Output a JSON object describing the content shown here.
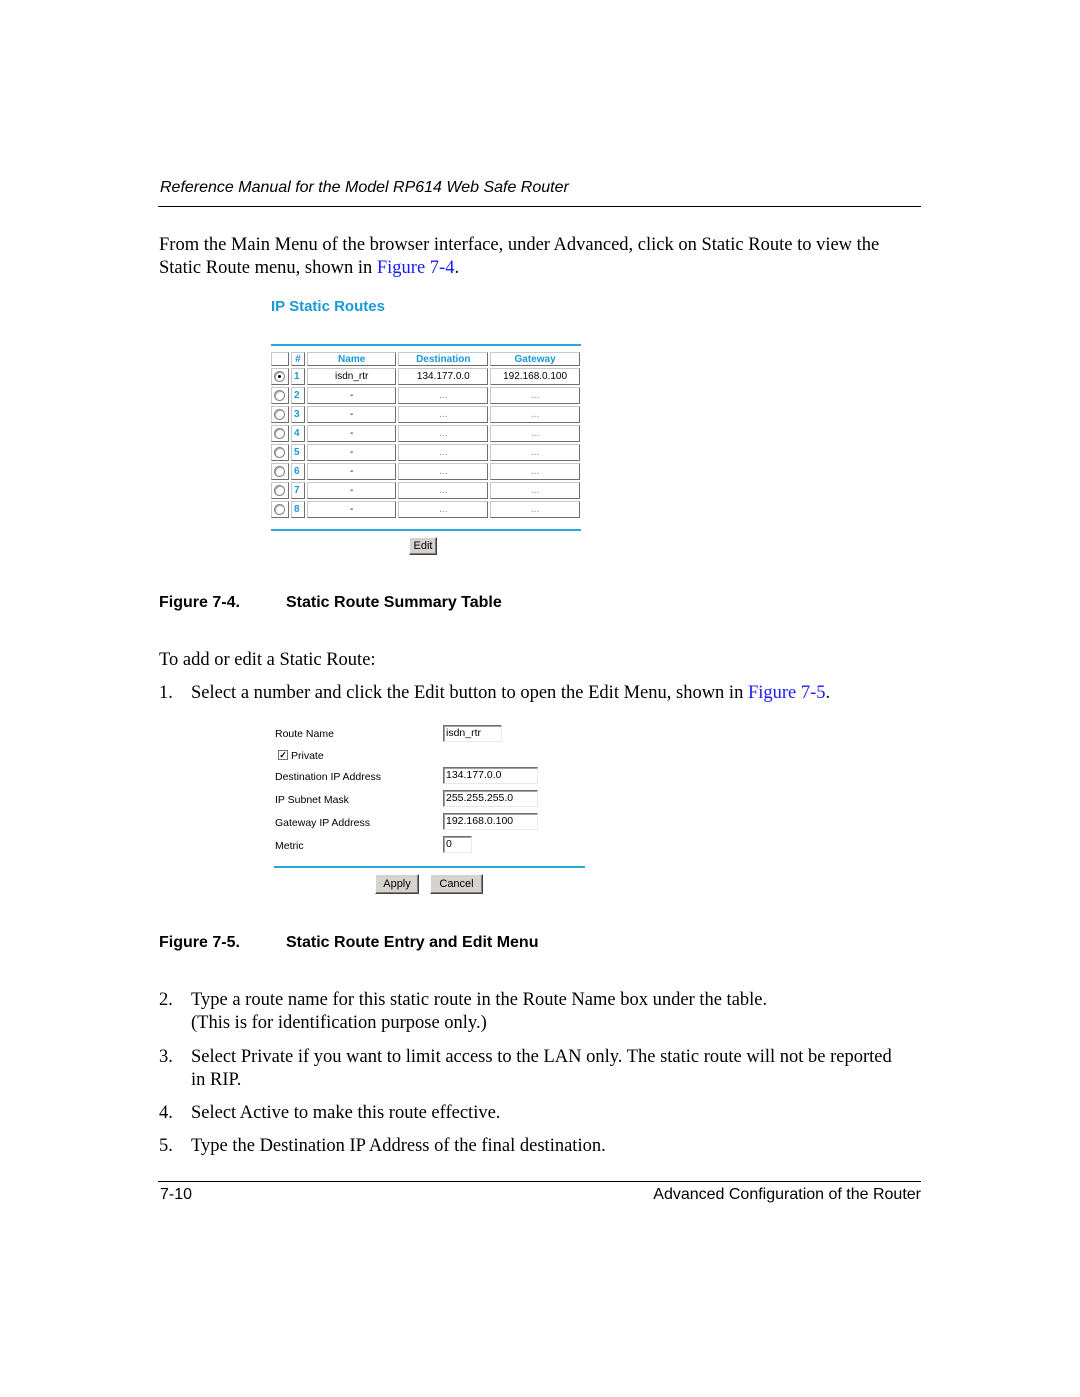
{
  "header": {
    "running_title": "Reference Manual for the Model RP614 Web Safe Router"
  },
  "intro": {
    "text_before_link": "From the Main Menu of the browser interface, under Advanced, click on Static Route to view the",
    "text_line2": "Static Route menu, shown in ",
    "link": "Figure 7-4",
    "text_after_link": "."
  },
  "figure_7_4": {
    "title": "IP Static Routes",
    "columns": [
      "#",
      "Name",
      "Destination",
      "Gateway"
    ],
    "rows": [
      {
        "selected": true,
        "num": "1",
        "name": "isdn_rtr",
        "destination": "134.177.0.0",
        "gateway": "192.168.0.100"
      },
      {
        "selected": false,
        "num": "2",
        "name": "-",
        "destination": "...",
        "gateway": "..."
      },
      {
        "selected": false,
        "num": "3",
        "name": "-",
        "destination": "...",
        "gateway": "..."
      },
      {
        "selected": false,
        "num": "4",
        "name": "-",
        "destination": "...",
        "gateway": "..."
      },
      {
        "selected": false,
        "num": "5",
        "name": "-",
        "destination": "...",
        "gateway": "..."
      },
      {
        "selected": false,
        "num": "6",
        "name": "-",
        "destination": "...",
        "gateway": "..."
      },
      {
        "selected": false,
        "num": "7",
        "name": "-",
        "destination": "...",
        "gateway": "..."
      },
      {
        "selected": false,
        "num": "8",
        "name": "-",
        "destination": "...",
        "gateway": "..."
      }
    ],
    "edit_button": "Edit",
    "caption_number": "Figure 7-4.",
    "caption_title": "Static Route Summary Table"
  },
  "steps_intro": "To add or edit a Static Route:",
  "step1": {
    "num": "1.",
    "text": "Select a number and click the Edit button to open the Edit Menu, shown in ",
    "link": "Figure 7-5",
    "after": "."
  },
  "figure_7_5": {
    "route_name_label": "Route Name",
    "route_name_value": "isdn_rtr",
    "private_label": "Private",
    "private_checked": true,
    "dest_label": "Destination IP Address",
    "dest_value": "134.177.0.0",
    "mask_label": "IP Subnet Mask",
    "mask_value": "255.255.255.0",
    "gateway_label": "Gateway IP Address",
    "gateway_value": "192.168.0.100",
    "metric_label": "Metric",
    "metric_value": "0",
    "apply_button": "Apply",
    "cancel_button": "Cancel",
    "caption_number": "Figure 7-5.",
    "caption_title": "Static Route Entry and Edit Menu"
  },
  "steps": [
    {
      "num": "2.",
      "line1": "Type a route name for this static route in the Route Name box under the table.",
      "line2": "(This is for identification purpose only.)"
    },
    {
      "num": "3.",
      "line1": "Select Private if you want to limit access to the LAN only. The static route will not be reported",
      "line2": "in RIP."
    },
    {
      "num": "4.",
      "line1": "Select Active to make this route effective."
    },
    {
      "num": "5.",
      "line1": "Type the Destination IP Address of the final destination."
    }
  ],
  "footer": {
    "page_number": "7-10",
    "section_title": "Advanced Configuration of the Router"
  }
}
